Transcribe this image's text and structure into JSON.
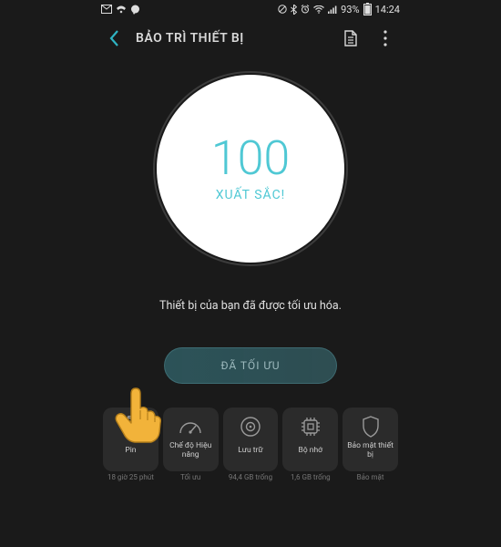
{
  "status": {
    "battery_percent": "93%",
    "time": "14:24"
  },
  "header": {
    "title": "BẢO TRÌ THIẾT BỊ"
  },
  "score": {
    "value": "100",
    "label": "XUẤT SẮC!"
  },
  "message": "Thiết bị của bạn đã được tối ưu hóa.",
  "action": {
    "optimize_label": "ĐÃ TỐI ƯU"
  },
  "cards": [
    {
      "label": "Pin",
      "sub": "18 giờ 25 phút"
    },
    {
      "label": "Chế độ Hiệu năng",
      "sub": "Tối ưu"
    },
    {
      "label": "Lưu trữ",
      "sub": "94,4 GB trống"
    },
    {
      "label": "Bộ nhớ",
      "sub": "1,6 GB trống"
    },
    {
      "label": "Bảo mật thiết bị",
      "sub": "Bảo mật"
    }
  ]
}
